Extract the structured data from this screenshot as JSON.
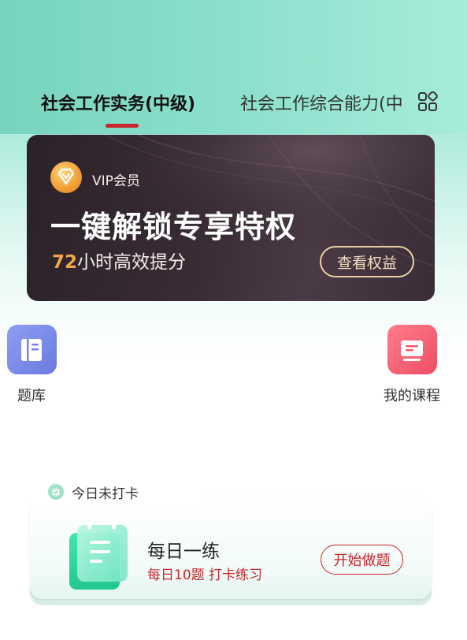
{
  "tabs": {
    "active_label": "社会工作实务(中级)",
    "inactive_label": "社会工作综合能力(中",
    "more_icon": "grid-icon"
  },
  "vip_banner": {
    "badge_icon": "diamond-icon",
    "label": "VIP会员",
    "title": "一键解锁专享特权",
    "subtitle_highlight": "72",
    "subtitle_rest": "小时高效提分",
    "button_label": "查看权益"
  },
  "quick_entries": [
    {
      "label": "题库",
      "icon": "book-icon"
    },
    {
      "label": "我的课程",
      "icon": "course-icon"
    }
  ],
  "daily_practice": {
    "status_icon": "calendar-check-icon",
    "status_text": "今日未打卡",
    "title": "每日一练",
    "subtitle": "每日10题 打卡练习",
    "button_label": "开始做题"
  },
  "colors": {
    "accent_red": "#c8262d",
    "vip_gold": "#f3a64b",
    "mint": "#8be0cb"
  }
}
